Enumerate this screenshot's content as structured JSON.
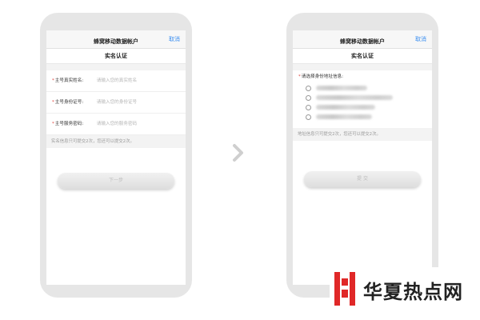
{
  "left_screen": {
    "nav_title": "蜂窝移动数据帐户",
    "cancel": "取消",
    "header": "实名认证",
    "fields": [
      {
        "required_mark": "*",
        "label": "主号真实姓名:",
        "placeholder": "请输入您的真实姓名"
      },
      {
        "required_mark": "*",
        "label": "主号身份证号:",
        "placeholder": "请输入您的身份证号"
      },
      {
        "required_mark": "*",
        "label": "主号服务密码:",
        "placeholder": "请输入您的服务密码"
      }
    ],
    "note": "实名信息只可提交2次，您还可以提交2次。",
    "next_button": "下一步"
  },
  "right_screen": {
    "nav_title": "蜂窝移动数据帐户",
    "cancel": "取消",
    "header": "实名认证",
    "prompt_mark": "*",
    "prompt": "请选择身份地址信息:",
    "note": "地址信息只可提交2次，您还可以提交2次。",
    "submit_button": "提 交"
  },
  "watermark": {
    "text": "华夏热点网"
  },
  "colors": {
    "accent": "#3b8ef0",
    "required": "#e0403a",
    "watermark_red": "#e02828"
  },
  "icons": {
    "arrow": "chevron-right-icon",
    "radio": "radio-unchecked-icon"
  }
}
